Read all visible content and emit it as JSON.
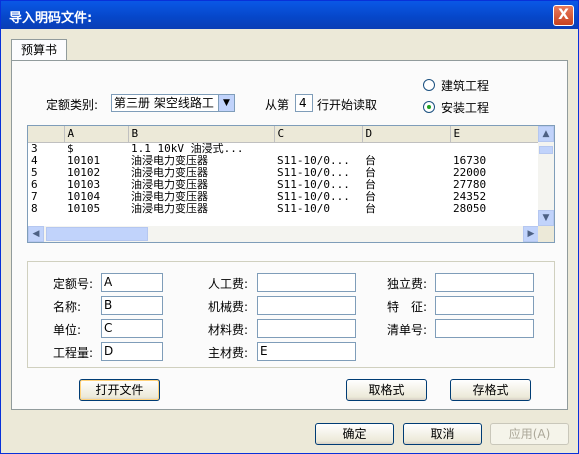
{
  "window": {
    "title": "导入明码文件:",
    "close_label": "X"
  },
  "tab": {
    "label": "预算书"
  },
  "quota": {
    "category_label": "定额类别:",
    "category_value": "第三册 架空线路工",
    "read_from_label": "从第",
    "read_from_value": "4",
    "read_from_suffix": "行开始读取"
  },
  "project_type": {
    "options": [
      "建筑工程",
      "安装工程"
    ],
    "selected": "安装工程"
  },
  "grid": {
    "columns": [
      "",
      "A",
      "B",
      "C",
      "D",
      "E"
    ],
    "rows": [
      [
        "3",
        "$",
        "1.1  10kV 油浸式...",
        "",
        "",
        ""
      ],
      [
        "4",
        "10101",
        "油浸电力变压器",
        "S11-10/0...",
        "台",
        "16730"
      ],
      [
        "5",
        "10102",
        "油浸电力变压器",
        "S11-10/0...",
        "台",
        "22000"
      ],
      [
        "6",
        "10103",
        "油浸电力变压器",
        "S11-10/0...",
        "台",
        "27780"
      ],
      [
        "7",
        "10104",
        "油浸电力变压器",
        "S11-10/0...",
        "台",
        "24352"
      ],
      [
        "8",
        "10105",
        "油浸电力变压器",
        "S11-10/0",
        "台",
        "28050"
      ]
    ]
  },
  "mapping": {
    "quota_no": {
      "label": "定额号:",
      "value": "A"
    },
    "name": {
      "label": "名称:",
      "value": "B"
    },
    "unit": {
      "label": "单位:",
      "value": "C"
    },
    "quantity": {
      "label": "工程量:",
      "value": "D"
    },
    "labor": {
      "label": "人工费:",
      "value": ""
    },
    "machine": {
      "label": "机械费:",
      "value": ""
    },
    "material": {
      "label": "材料费:",
      "value": ""
    },
    "main_material": {
      "label": "主材费:",
      "value": "E"
    },
    "standalone": {
      "label": "独立费:",
      "value": ""
    },
    "feature": {
      "label": "特　征:",
      "value": ""
    },
    "bill_no": {
      "label": "清单号:",
      "value": ""
    }
  },
  "buttons": {
    "open_file": "打开文件",
    "get_format": "取格式",
    "save_format": "存格式",
    "ok": "确定",
    "cancel": "取消",
    "apply": "应用(A)"
  }
}
